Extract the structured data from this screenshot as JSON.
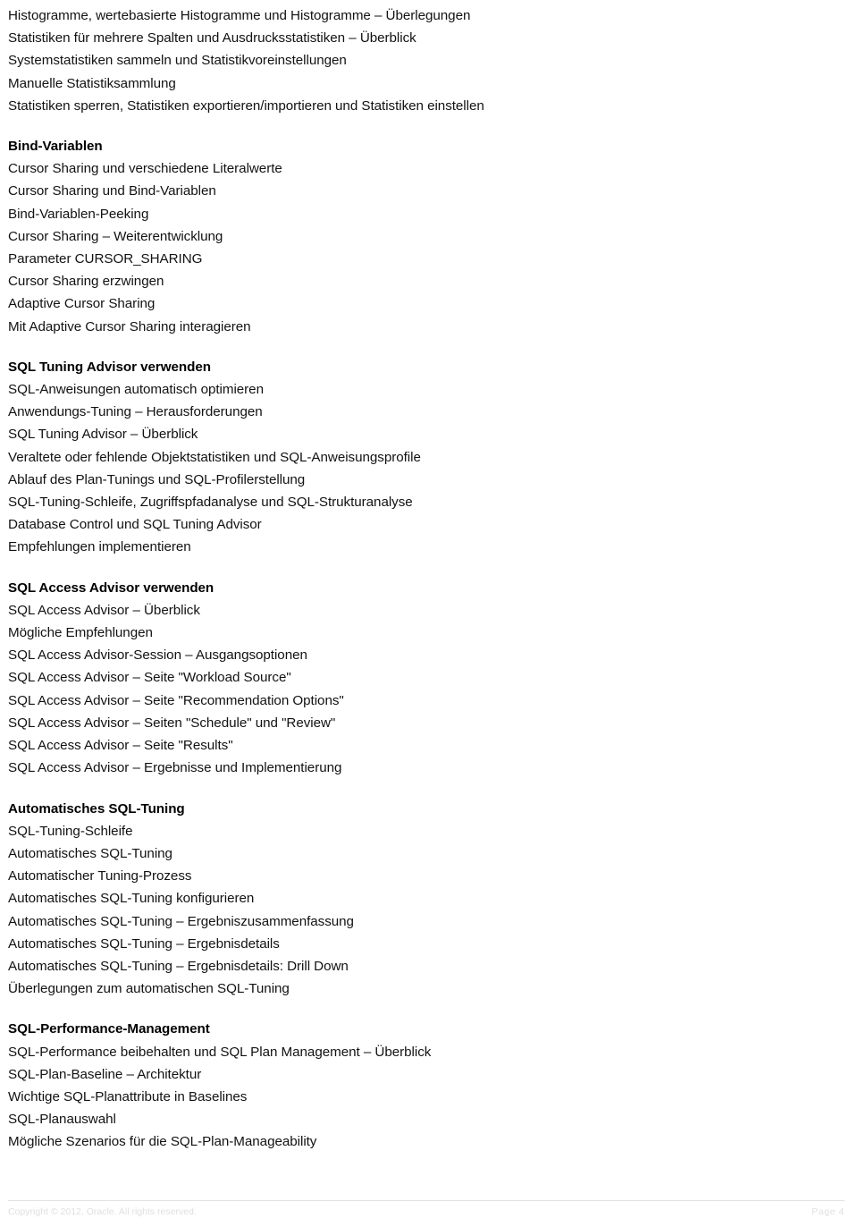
{
  "document": {
    "page_label": "Page  4",
    "copyright": "Copyright © 2012, Oracle. All rights reserved."
  },
  "toc": {
    "blocks": [
      {
        "heading": null,
        "entries": [
          "Histogramme, wertebasierte Histogramme und Histogramme – Überlegungen",
          "Statistiken für mehrere Spalten und Ausdrucksstatistiken – Überblick",
          "Systemstatistiken sammeln und Statistikvoreinstellungen",
          "Manuelle Statistiksammlung",
          "Statistiken sperren, Statistiken exportieren/importieren und Statistiken einstellen"
        ]
      },
      {
        "heading": "Bind-Variablen",
        "entries": [
          "Cursor Sharing und verschiedene Literalwerte",
          "Cursor Sharing und Bind-Variablen",
          "Bind-Variablen-Peeking",
          "Cursor Sharing – Weiterentwicklung",
          "Parameter CURSOR_SHARING",
          "Cursor Sharing erzwingen",
          "Adaptive Cursor Sharing",
          "Mit Adaptive Cursor Sharing interagieren"
        ]
      },
      {
        "heading": "SQL Tuning Advisor verwenden",
        "entries": [
          "SQL-Anweisungen automatisch optimieren",
          "Anwendungs-Tuning – Herausforderungen",
          "SQL Tuning Advisor – Überblick",
          "Veraltete oder fehlende Objektstatistiken und SQL-Anweisungsprofile",
          "Ablauf des Plan-Tunings und SQL-Profilerstellung",
          "SQL-Tuning-Schleife, Zugriffspfadanalyse und SQL-Strukturanalyse",
          "Database Control und SQL Tuning Advisor",
          "Empfehlungen implementieren"
        ]
      },
      {
        "heading": "SQL Access Advisor verwenden",
        "entries": [
          "SQL Access Advisor – Überblick",
          "Mögliche Empfehlungen",
          "SQL Access Advisor-Session – Ausgangsoptionen",
          "SQL Access Advisor – Seite \"Workload Source\"",
          "SQL Access Advisor – Seite \"Recommendation Options\"",
          "SQL Access Advisor – Seiten \"Schedule\" und \"Review\"",
          "SQL Access Advisor – Seite \"Results\"",
          "SQL Access Advisor – Ergebnisse und Implementierung"
        ]
      },
      {
        "heading": "Automatisches SQL-Tuning",
        "entries": [
          "SQL-Tuning-Schleife",
          "Automatisches SQL-Tuning",
          "Automatischer Tuning-Prozess",
          "Automatisches SQL-Tuning konfigurieren",
          "Automatisches SQL-Tuning – Ergebniszusammenfassung",
          "Automatisches SQL-Tuning – Ergebnisdetails",
          "Automatisches SQL-Tuning – Ergebnisdetails: Drill Down",
          "Überlegungen zum automatischen SQL-Tuning"
        ]
      },
      {
        "heading": "SQL-Performance-Management",
        "entries": [
          "SQL-Performance beibehalten und SQL Plan Management – Überblick",
          "SQL-Plan-Baseline – Architektur",
          "Wichtige SQL-Planattribute in Baselines",
          "SQL-Planauswahl",
          "Mögliche Szenarios für die SQL-Plan-Manageability"
        ]
      }
    ]
  }
}
